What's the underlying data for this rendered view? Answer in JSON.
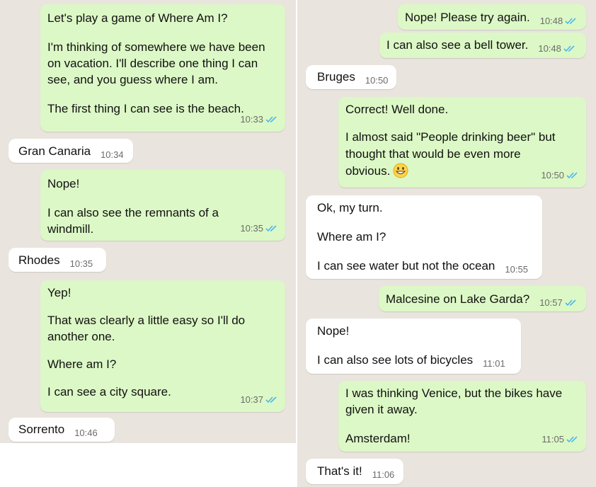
{
  "colors": {
    "outgoing": "#dcf8c6",
    "incoming": "#ffffff",
    "wallpaper": "#e9e4dd",
    "read_tick": "#4fb6ec"
  },
  "icons": {
    "read_receipt": "double-check-icon",
    "emoji": "grinning-face-emoji"
  },
  "left": {
    "m1": {
      "paragraphs": [
        "Let's play a game of Where Am I?",
        "I'm thinking of somewhere we have been on vacation. I'll describe one thing I can see, and you guess where I am.",
        "The first thing I can see is the beach."
      ],
      "time": "10:33"
    },
    "m2": {
      "text": "Gran Canaria",
      "time": "10:34"
    },
    "m3": {
      "paragraphs": [
        "Nope!",
        "I can also see the remnants of a windmill."
      ],
      "time": "10:35"
    },
    "m4": {
      "text": "Rhodes",
      "time": "10:35"
    },
    "m5": {
      "paragraphs": [
        "Yep!",
        "That was clearly a little easy so I'll do another one.",
        "Where am I?",
        "I can see a city square."
      ],
      "time": "10:37"
    },
    "m6": {
      "text": "Sorrento",
      "time": "10:46"
    }
  },
  "right": {
    "m1": {
      "text": "Nope! Please try again.",
      "time": "10:48"
    },
    "m2": {
      "text": "I can also see a bell tower.",
      "time": "10:48"
    },
    "m3": {
      "text": "Bruges",
      "time": "10:50"
    },
    "m4": {
      "paragraphs": [
        "Correct! Well done.",
        "I almost said \"People drinking beer\" but thought that would be even more obvious."
      ],
      "time": "10:50"
    },
    "m5": {
      "paragraphs": [
        "Ok, my turn.",
        "Where am I?"
      ],
      "last": "I can see water but not the ocean",
      "time": "10:55"
    },
    "m6": {
      "text": "Malcesine on Lake Garda?",
      "time": "10:57"
    },
    "m7": {
      "paragraphs": [
        "Nope!"
      ],
      "last": "I can also see lots of bicycles",
      "time": "11:01"
    },
    "m8": {
      "paragraphs": [
        "I was thinking Venice, but the bikes have given it away.",
        "Amsterdam!"
      ],
      "time": "11:05"
    },
    "m9": {
      "text": "That's it!",
      "time": "11:06"
    }
  }
}
